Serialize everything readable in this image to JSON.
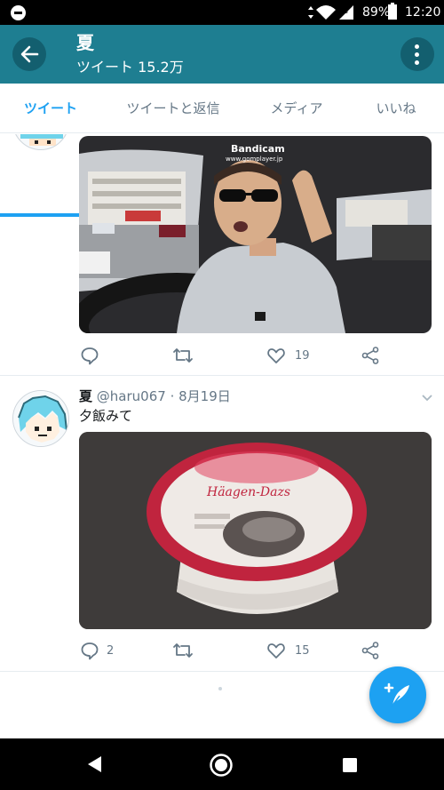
{
  "status_bar": {
    "battery": "89%",
    "time": "12:20"
  },
  "header": {
    "title": "夏",
    "subtitle": "ツイート 15.2万"
  },
  "tabs": [
    {
      "label": "ツイート",
      "active": true
    },
    {
      "label": "ツイートと返信",
      "active": false
    },
    {
      "label": "メディア",
      "active": false
    },
    {
      "label": "いいね",
      "active": false
    }
  ],
  "tweets": [
    {
      "media_overlay": "Bandicam",
      "media_overlay_url": "www.gomplayer.jp",
      "reply_count": "",
      "like_count": "19"
    },
    {
      "name": "夏",
      "handle": "@haru067 · 8月19日",
      "text": "夕飯みて",
      "media_label": "Häagen-Dazs",
      "reply_count": "2",
      "like_count": "15"
    }
  ],
  "colors": {
    "appbar": "#1e7e91",
    "accent": "#1da1f2",
    "muted": "#657786"
  }
}
